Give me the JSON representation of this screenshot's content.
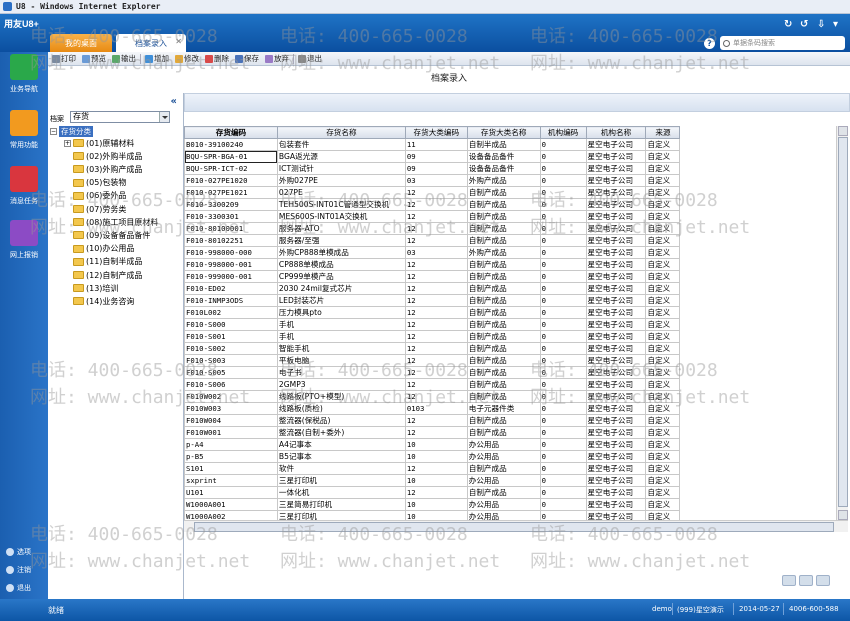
{
  "window": {
    "title": "U8 - Windows Internet Explorer"
  },
  "header": {
    "logo": "用友U8+",
    "tabs": [
      {
        "label": "我的桌面"
      },
      {
        "label": "档案录入"
      }
    ],
    "search_placeholder": "单据条码搜索"
  },
  "nav": {
    "items": [
      {
        "label": "业务导航"
      },
      {
        "label": "常用功能"
      },
      {
        "label": "消息任务"
      },
      {
        "label": "网上报销"
      }
    ],
    "bottom": [
      {
        "label": "选项"
      },
      {
        "label": "注销"
      },
      {
        "label": "退出"
      }
    ]
  },
  "toolbar": {
    "items": [
      {
        "label": "打印",
        "icon": "print-icon"
      },
      {
        "label": "预览",
        "icon": "preview-icon"
      },
      {
        "label": "输出",
        "icon": "export-icon"
      },
      {
        "label": "增加",
        "icon": "add-icon"
      },
      {
        "label": "修改",
        "icon": "edit-icon"
      },
      {
        "label": "删除",
        "icon": "delete-icon"
      },
      {
        "label": "保存",
        "icon": "save-icon"
      },
      {
        "label": "放弃",
        "icon": "discard-icon"
      },
      {
        "label": "退出",
        "icon": "exit-icon"
      }
    ]
  },
  "page": {
    "title": "档案录入"
  },
  "tree": {
    "archive_label": "档案",
    "archive_value": "存货",
    "root": "存货分类",
    "nodes": [
      {
        "label": "(01)原辅材料"
      },
      {
        "label": "(02)外购半成品"
      },
      {
        "label": "(03)外购产成品"
      },
      {
        "label": "(05)包装物"
      },
      {
        "label": "(06)委外品"
      },
      {
        "label": "(07)劳务类"
      },
      {
        "label": "(08)施工项目原材料"
      },
      {
        "label": "(09)设备备品备件"
      },
      {
        "label": "(10)办公用品"
      },
      {
        "label": "(11)自制半成品"
      },
      {
        "label": "(12)自制产成品"
      },
      {
        "label": "(13)培训"
      },
      {
        "label": "(14)业务咨询"
      }
    ]
  },
  "table": {
    "columns": [
      "存货编码",
      "存货名称",
      "存货大类编码",
      "存货大类名称",
      "机构编码",
      "机构名称",
      "来源"
    ],
    "rows": [
      [
        "B010-39100240",
        "包装套件",
        "11",
        "自制半成品",
        "0",
        "星空电子公司",
        "自定义"
      ],
      [
        "BQU-SPR-BGA-01",
        "BGA返光源",
        "09",
        "设备备品备件",
        "0",
        "星空电子公司",
        "自定义"
      ],
      [
        "BQU-SPR-ICT-02",
        "ICT测试针",
        "09",
        "设备备品备件",
        "0",
        "星空电子公司",
        "自定义"
      ],
      [
        "F010-027PE1020",
        "外购027PE",
        "03",
        "外购产成品",
        "0",
        "星空电子公司",
        "自定义"
      ],
      [
        "F010-027PE1021",
        "027PE",
        "12",
        "自制产成品",
        "0",
        "星空电子公司",
        "自定义"
      ],
      [
        "F010-3300209",
        "TEH500S-INT01C管通型交换机",
        "12",
        "自制产成品",
        "0",
        "星空电子公司",
        "自定义"
      ],
      [
        "F010-3300301",
        "MES600S-INT01A交换机",
        "12",
        "自制产成品",
        "0",
        "星空电子公司",
        "自定义"
      ],
      [
        "F010-80100001",
        "服务器-ATO",
        "12",
        "自制产成品",
        "0",
        "星空电子公司",
        "自定义"
      ],
      [
        "F010-80102251",
        "服务器/至强",
        "12",
        "自制产成品",
        "0",
        "星空电子公司",
        "自定义"
      ],
      [
        "F010-998000-000",
        "外购CP888单模成品",
        "03",
        "外购产成品",
        "0",
        "星空电子公司",
        "自定义"
      ],
      [
        "F010-998000-001",
        "CP888单模成品",
        "12",
        "自制产成品",
        "0",
        "星空电子公司",
        "自定义"
      ],
      [
        "F010-999000-001",
        "CP999单模产品",
        "12",
        "自制产成品",
        "0",
        "星空电子公司",
        "自定义"
      ],
      [
        "F010-ED02",
        "2030 24mil复式芯片",
        "12",
        "自制产成品",
        "0",
        "星空电子公司",
        "自定义"
      ],
      [
        "F010-INMP3ODS",
        "LED封装芯片",
        "12",
        "自制产成品",
        "0",
        "星空电子公司",
        "自定义"
      ],
      [
        "F010L002",
        "压力模具pto",
        "12",
        "自制产成品",
        "0",
        "星空电子公司",
        "自定义"
      ],
      [
        "F010-S000",
        "手机",
        "12",
        "自制产成品",
        "0",
        "星空电子公司",
        "自定义"
      ],
      [
        "F010-S001",
        "手机",
        "12",
        "自制产成品",
        "0",
        "星空电子公司",
        "自定义"
      ],
      [
        "F010-S002",
        "智能手机",
        "12",
        "自制产成品",
        "0",
        "星空电子公司",
        "自定义"
      ],
      [
        "F010-S003",
        "平板电脑",
        "12",
        "自制产成品",
        "0",
        "星空电子公司",
        "自定义"
      ],
      [
        "F010-S005",
        "电子书",
        "12",
        "自制产成品",
        "0",
        "星空电子公司",
        "自定义"
      ],
      [
        "F010-S006",
        "2GMP3",
        "12",
        "自制产成品",
        "0",
        "星空电子公司",
        "自定义"
      ],
      [
        "F010W002",
        "线路板(PTO+模型)",
        "12",
        "自制产成品",
        "0",
        "星空电子公司",
        "自定义"
      ],
      [
        "F010W003",
        "线路板(质检)",
        "0103",
        "电子元器件类",
        "0",
        "星空电子公司",
        "自定义"
      ],
      [
        "F010W004",
        "整流器(保税品)",
        "12",
        "自制产成品",
        "0",
        "星空电子公司",
        "自定义"
      ],
      [
        "F010W001",
        "整流器(自制+委外)",
        "12",
        "自制产成品",
        "0",
        "星空电子公司",
        "自定义"
      ],
      [
        "p-A4",
        "A4记事本",
        "10",
        "办公用品",
        "0",
        "星空电子公司",
        "自定义"
      ],
      [
        "p-B5",
        "B5记事本",
        "10",
        "办公用品",
        "0",
        "星空电子公司",
        "自定义"
      ],
      [
        "S101",
        "软件",
        "12",
        "自制产成品",
        "0",
        "星空电子公司",
        "自定义"
      ],
      [
        "sxprint",
        "三星打印机",
        "10",
        "办公用品",
        "0",
        "星空电子公司",
        "自定义"
      ],
      [
        "U101",
        "一体化机",
        "12",
        "自制产成品",
        "0",
        "星空电子公司",
        "自定义"
      ],
      [
        "W1000A001",
        "三星简易打印机",
        "10",
        "办公用品",
        "0",
        "星空电子公司",
        "自定义"
      ],
      [
        "W1000A002",
        "三星打印机",
        "10",
        "办公用品",
        "0",
        "星空电子公司",
        "自定义"
      ]
    ]
  },
  "status": {
    "ready": "就绪",
    "user": "demo",
    "account": "(999)星空演示",
    "date": "2014-05-27",
    "phone": "4006-600-588"
  },
  "watermark": {
    "phone": "电话: 400-665-0028",
    "site": "网址: www.chanjet.net"
  },
  "colors": {
    "header": "#1566bd",
    "tab_active": "#f0a030",
    "nav": "#2068b8"
  }
}
